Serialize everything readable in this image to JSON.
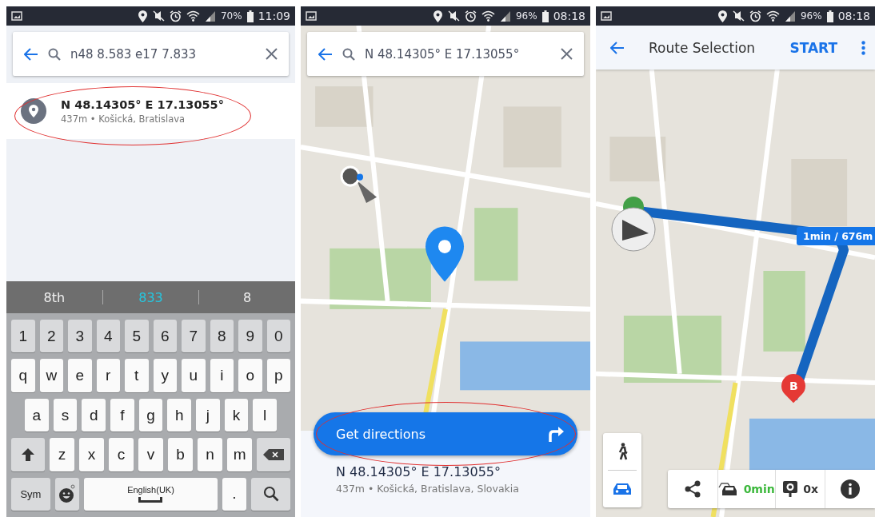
{
  "screens": [
    {
      "kind": "search",
      "status_bar": {
        "battery": "70%",
        "time": "11:09"
      },
      "search_field": {
        "value": "n48 8.583 e17 7.833"
      },
      "results": [
        {
          "title": "N 48.14305° E 17.13055°",
          "subtitle": "437m • Košická, Bratislava",
          "circled": true
        }
      ],
      "keyboard": {
        "suggestions": [
          {
            "text": "8th",
            "selected": false
          },
          {
            "text": "833",
            "selected": true
          },
          {
            "text": "8",
            "selected": false
          }
        ],
        "rows": [
          {
            "keys": [
              {
                "kind": "digit",
                "label": "1"
              },
              {
                "kind": "digit",
                "label": "2"
              },
              {
                "kind": "digit",
                "label": "3"
              },
              {
                "kind": "digit",
                "label": "4"
              },
              {
                "kind": "digit",
                "label": "5"
              },
              {
                "kind": "digit",
                "label": "6"
              },
              {
                "kind": "digit",
                "label": "7"
              },
              {
                "kind": "digit",
                "label": "8"
              },
              {
                "kind": "digit",
                "label": "9"
              },
              {
                "kind": "digit",
                "label": "0"
              }
            ]
          },
          {
            "keys": [
              {
                "kind": "char",
                "label": "q"
              },
              {
                "kind": "char",
                "label": "w"
              },
              {
                "kind": "char",
                "label": "e"
              },
              {
                "kind": "char",
                "label": "r"
              },
              {
                "kind": "char",
                "label": "t"
              },
              {
                "kind": "char",
                "label": "y"
              },
              {
                "kind": "char",
                "label": "u"
              },
              {
                "kind": "char",
                "label": "i"
              },
              {
                "kind": "char",
                "label": "o"
              },
              {
                "kind": "char",
                "label": "p"
              }
            ]
          },
          {
            "keys": [
              {
                "kind": "char",
                "label": "a"
              },
              {
                "kind": "char",
                "label": "s"
              },
              {
                "kind": "char",
                "label": "d"
              },
              {
                "kind": "char",
                "label": "f"
              },
              {
                "kind": "char",
                "label": "g"
              },
              {
                "kind": "char",
                "label": "h"
              },
              {
                "kind": "char",
                "label": "j"
              },
              {
                "kind": "char",
                "label": "k"
              },
              {
                "kind": "char",
                "label": "l"
              }
            ]
          },
          {
            "keys": [
              {
                "kind": "shift"
              },
              {
                "kind": "char",
                "label": "z"
              },
              {
                "kind": "char",
                "label": "x"
              },
              {
                "kind": "char",
                "label": "c"
              },
              {
                "kind": "char",
                "label": "v"
              },
              {
                "kind": "char",
                "label": "b"
              },
              {
                "kind": "char",
                "label": "n"
              },
              {
                "kind": "char",
                "label": "m"
              },
              {
                "kind": "backspace"
              }
            ]
          },
          {
            "keys": [
              {
                "kind": "sym",
                "label": "Sym"
              },
              {
                "kind": "emoji"
              },
              {
                "kind": "space",
                "label": "English(UK)"
              },
              {
                "kind": "period",
                "label": "."
              },
              {
                "kind": "search"
              }
            ]
          }
        ]
      }
    },
    {
      "kind": "place",
      "status_bar": {
        "battery": "96%",
        "time": "08:18"
      },
      "search_field": {
        "value": "N 48.14305° E 17.13055°"
      },
      "action_button": {
        "label": "Get directions",
        "circled": true
      },
      "place": {
        "title": "N 48.14305° E 17.13055°",
        "subtitle": "437m • Košická, Bratislava, Slovakia"
      }
    },
    {
      "kind": "route",
      "status_bar": {
        "battery": "96%",
        "time": "08:18"
      },
      "header": {
        "title": "Route Selection",
        "action": "START"
      },
      "route_label": "1min / 676m",
      "destination_marker": "B",
      "modes": [
        {
          "kind": "walk",
          "selected": false
        },
        {
          "kind": "car",
          "selected": true
        }
      ],
      "toolbar": [
        {
          "kind": "share"
        },
        {
          "kind": "traffic",
          "label": "0min"
        },
        {
          "kind": "camera",
          "label": "0x"
        },
        {
          "kind": "info"
        }
      ]
    }
  ]
}
